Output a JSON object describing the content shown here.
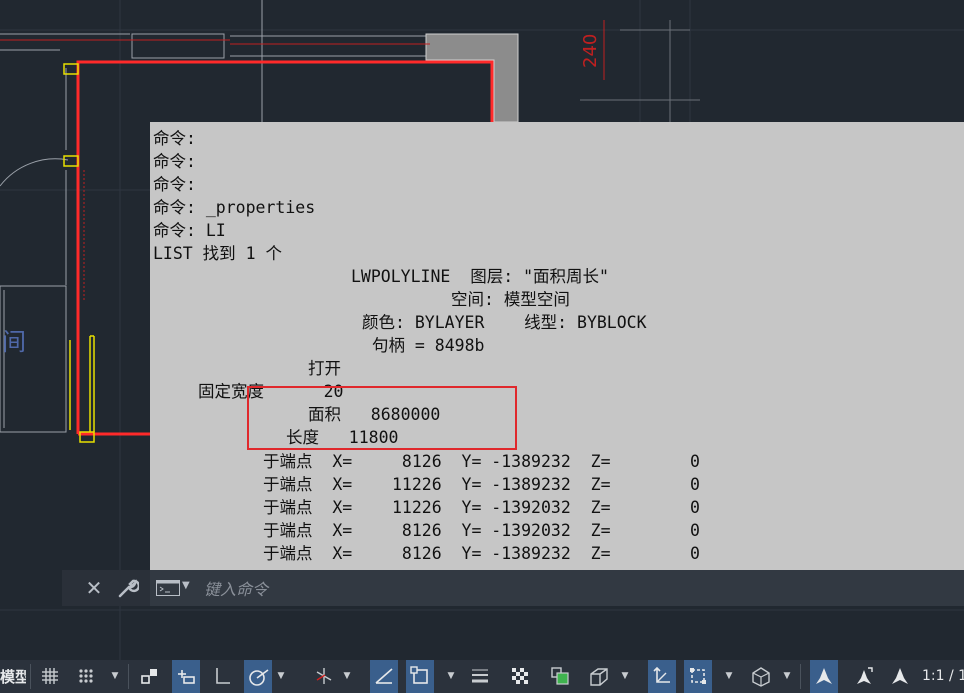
{
  "drawing": {
    "room_label": "间",
    "dimension_text": "240"
  },
  "history": {
    "lines": [
      "命令:",
      "命令:",
      "命令:",
      "命令: _properties",
      "命令: LI",
      "LIST 找到 1 个",
      "LWPOLYLINE  图层: \"面积周长\"",
      "空间: 模型空间",
      "颜色: BYLAYER    线型: BYBLOCK",
      "句柄 = 8498b",
      "打开",
      "固定宽度      20",
      "面积   8680000",
      "长度   11800",
      "于端点  X=     8126  Y= -1389232  Z=        0",
      "于端点  X=    11226  Y= -1389232  Z=        0",
      "于端点  X=    11226  Y= -1392032  Z=        0",
      "于端点  X=     8126  Y= -1392032  Z=        0",
      "于端点  X=     8126  Y= -1389232  Z=        0"
    ]
  },
  "commandline": {
    "close_icon": "close-icon",
    "customize_icon": "wrench-icon",
    "prompt_icon": "command-prompt-icon",
    "placeholder": "键入命令"
  },
  "statusbar": {
    "model_label": "模型",
    "scale_label": "1:1 / 1"
  },
  "colors": {
    "canvas": "#212830",
    "history_bg": "#c6c6c6",
    "highlight": "#e0282c",
    "active_button": "#3a5f8c"
  }
}
